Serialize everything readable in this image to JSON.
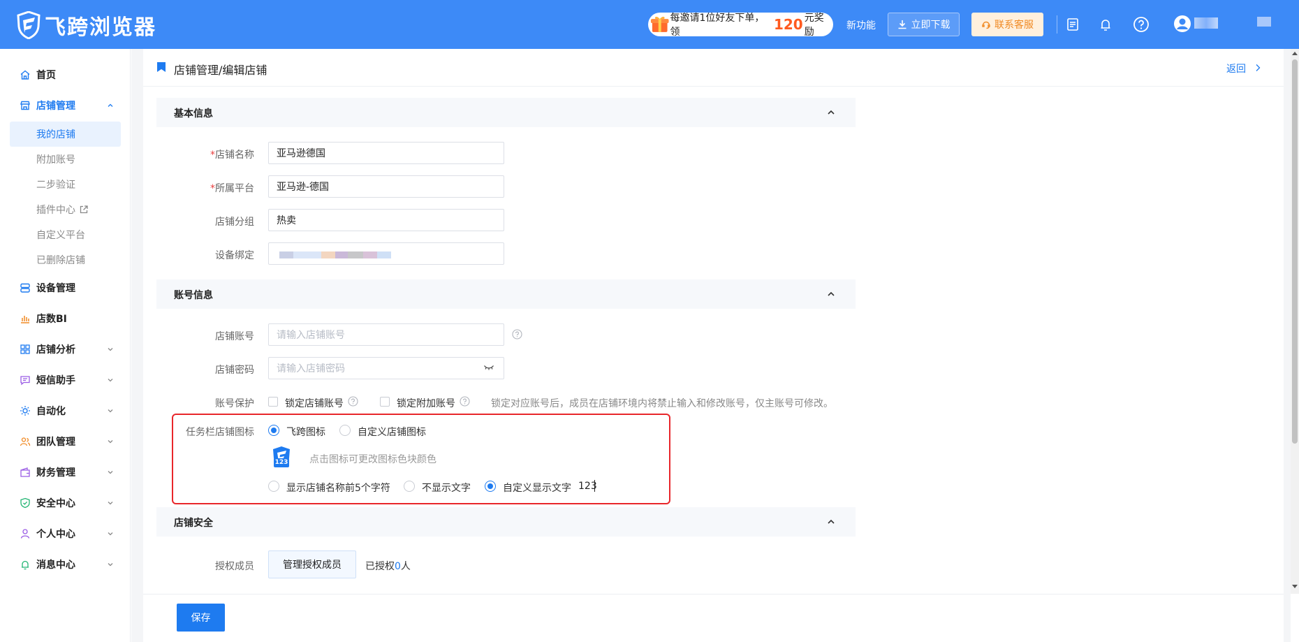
{
  "header": {
    "app_name": "飞跨浏览器",
    "promo": {
      "before": "每邀请1位好友下单，领",
      "amount": "120",
      "after": "元奖励"
    },
    "new_feature": "新功能",
    "download": "立即下载",
    "support": "联系客服"
  },
  "sidebar": {
    "home": "首页",
    "store_mgmt": "店铺管理",
    "sub": {
      "my_stores": "我的店铺",
      "extra_accounts": "附加账号",
      "two_step": "二步验证",
      "plugins": "插件中心",
      "custom_platform": "自定义平台",
      "deleted_stores": "已删除店铺"
    },
    "device_mgmt": "设备管理",
    "store_bi": "店数BI",
    "store_analysis": "店铺分析",
    "sms": "短信助手",
    "automation": "自动化",
    "team": "团队管理",
    "finance": "财务管理",
    "security": "安全中心",
    "personal": "个人中心",
    "messages": "消息中心"
  },
  "page": {
    "breadcrumb": "店铺管理/编辑店铺",
    "back": "返回"
  },
  "basic": {
    "title": "基本信息",
    "store_name_label": "店铺名称",
    "store_name": "亚马逊德国",
    "platform_label": "所属平台",
    "platform": "亚马逊-德国",
    "group_label": "店铺分组",
    "group": "热卖",
    "device_label": "设备绑定",
    "required_mark": "*"
  },
  "account": {
    "title": "账号信息",
    "account_label": "店铺账号",
    "account_placeholder": "请输入店铺账号",
    "password_label": "店铺密码",
    "password_placeholder": "请输入店铺密码",
    "protect_label": "账号保护",
    "lock_store_account": "锁定店铺账号",
    "lock_extra_account": "锁定附加账号",
    "protect_hint": "锁定对应账号后，成员在店铺环境内将禁止输入和修改账号，仅主账号可修改。"
  },
  "taskbar": {
    "label": "任务栏店铺图标",
    "opt_feikua": "飞跨图标",
    "opt_custom": "自定义店铺图标",
    "icon_badge": "123",
    "icon_hint": "点击图标可更改图标色块颜色",
    "text_first5": "显示店铺名称前5个字符",
    "text_none": "不显示文字",
    "text_custom": "自定义显示文字",
    "custom_value": "123"
  },
  "security": {
    "title": "店铺安全",
    "auth_label": "授权成员",
    "manage_btn": "管理授权成员",
    "authorized_prefix": "已授权",
    "authorized_count": "0",
    "authorized_suffix": "人"
  },
  "footer": {
    "save": "保存"
  },
  "colors": {
    "header_bg": "#3d8af7",
    "primary": "#1e7bf0",
    "highlight_border": "#e8262b"
  }
}
